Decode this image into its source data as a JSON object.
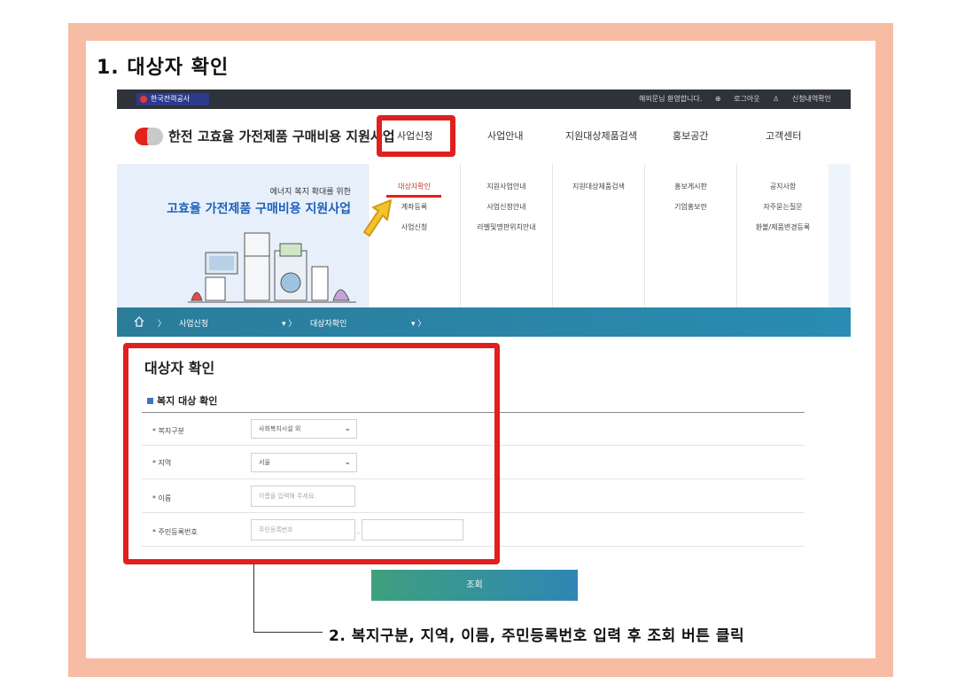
{
  "step1": "1. 대상자 확인",
  "topbar": {
    "logo": "한국전력공사",
    "welcome": "해외문님 환영합니다.",
    "logout": "로그아웃",
    "mypage": "신청내역확인"
  },
  "header": {
    "brand": "한전 고효율 가전제품 구매비용 지원사업",
    "nav": [
      "사업신청",
      "사업안내",
      "지원대상제품검색",
      "홍보공간",
      "고객센터"
    ]
  },
  "mega": {
    "sub": "에너지 복지 확대를 위한",
    "title": "고효율 가전제품 구매비용 지원사업",
    "columns": [
      [
        "대상자확인",
        "계좌등록",
        "사업신청"
      ],
      [
        "지원사업안내",
        "사업신청안내",
        "라벨및명판위치안내"
      ],
      [
        "지원대상제품검색"
      ],
      [
        "홍보게시판",
        "기업홍보란"
      ],
      [
        "공지사항",
        "자주묻는질문",
        "환불/제품변경등록"
      ]
    ]
  },
  "breadcrumb": {
    "level1": "사업신청",
    "level2": "대상자확인"
  },
  "form": {
    "title": "대상자 확인",
    "subtitle": "복지 대상 확인",
    "welfare_label": "* 복지구분",
    "welfare_value": "사회복지시설 외",
    "region_label": "* 지역",
    "region_value": "서울",
    "name_label": "* 이름",
    "name_placeholder": "이름을 입력해 주세요.",
    "rrn_label": "* 주민등록번호",
    "rrn_placeholder": "주민등록번호",
    "search_button": "조회"
  },
  "step2": "2. 복지구분, 지역, 이름, 주민등록번호 입력 후 조회 버튼 클릭",
  "colors": {
    "highlight": "#e01f1f",
    "frame": "#f7bca4",
    "breadcrumb": "#2a8cb2",
    "arrow": "#f2c230"
  }
}
